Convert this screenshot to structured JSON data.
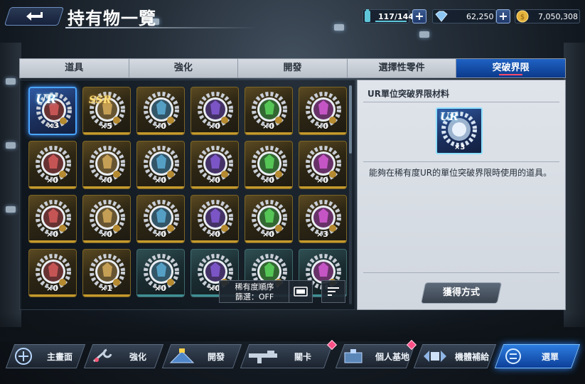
{
  "header": {
    "title": "持有物一覽",
    "stamina": "117/144",
    "gems": "62,250",
    "coins": "7,050,308",
    "plus_symbol": "+"
  },
  "tabs": [
    {
      "label": "道具",
      "active": false
    },
    {
      "label": "強化",
      "active": false
    },
    {
      "label": "開發",
      "active": false
    },
    {
      "label": "選擇性零件",
      "active": false
    },
    {
      "label": "突破界限",
      "active": true
    }
  ],
  "grid": {
    "items": [
      {
        "rank": "UR",
        "count": "×3",
        "frame": "selected"
      },
      {
        "rank": "SSR",
        "count": "×5",
        "frame": "gold"
      },
      {
        "rank": "",
        "count": "×0",
        "frame": "gold"
      },
      {
        "rank": "",
        "count": "×0",
        "frame": "gold"
      },
      {
        "rank": "",
        "count": "×0",
        "frame": "gold"
      },
      {
        "rank": "",
        "count": "×0",
        "frame": "gold"
      },
      {
        "rank": "",
        "count": "×0",
        "frame": "gold"
      },
      {
        "rank": "",
        "count": "×0",
        "frame": "gold"
      },
      {
        "rank": "",
        "count": "×0",
        "frame": "gold"
      },
      {
        "rank": "",
        "count": "×0",
        "frame": "gold"
      },
      {
        "rank": "",
        "count": "×0",
        "frame": "gold"
      },
      {
        "rank": "",
        "count": "×0",
        "frame": "gold"
      },
      {
        "rank": "",
        "count": "×0",
        "frame": "gold"
      },
      {
        "rank": "",
        "count": "×0",
        "frame": "gold"
      },
      {
        "rank": "",
        "count": "×0",
        "frame": "gold"
      },
      {
        "rank": "",
        "count": "×0",
        "frame": "gold"
      },
      {
        "rank": "",
        "count": "×0",
        "frame": "gold"
      },
      {
        "rank": "",
        "count": "×3",
        "frame": "gold"
      },
      {
        "rank": "",
        "count": "×0",
        "frame": "gold"
      },
      {
        "rank": "",
        "count": "×1",
        "frame": "gold"
      },
      {
        "rank": "",
        "count": "×0",
        "frame": "teal"
      },
      {
        "rank": "",
        "count": "×0",
        "frame": "teal"
      },
      {
        "rank": "",
        "count": "",
        "frame": "teal"
      },
      {
        "rank": "",
        "count": "",
        "frame": "teal"
      }
    ],
    "sort_label": "稀有度順序",
    "filter_label": "篩選：OFF"
  },
  "detail": {
    "title": "UR單位突破界限材料",
    "rank": "UR",
    "count": "×3",
    "description": "能夠在稀有度UR的單位突破界限時使用的道具。",
    "obtain_button": "獲得方式"
  },
  "nav": [
    {
      "label": "主畫面",
      "icon": "home-icon",
      "badge": false
    },
    {
      "label": "強化",
      "icon": "wrench-icon",
      "badge": false
    },
    {
      "label": "開發",
      "icon": "develop-icon",
      "badge": false
    },
    {
      "label": "關卡",
      "icon": "rifle-icon",
      "badge": true
    },
    {
      "label": "個人基地",
      "icon": "base-icon",
      "badge": true
    },
    {
      "label": "機體補給",
      "icon": "supply-icon",
      "badge": false
    },
    {
      "label": "選單",
      "icon": "menu-icon",
      "badge": false
    }
  ],
  "colors": {
    "accent_blue": "#1f62c4",
    "gold_frame": "#c59a2c",
    "teal_frame": "#3f8f95",
    "badge_pink": "#ff4f87"
  }
}
